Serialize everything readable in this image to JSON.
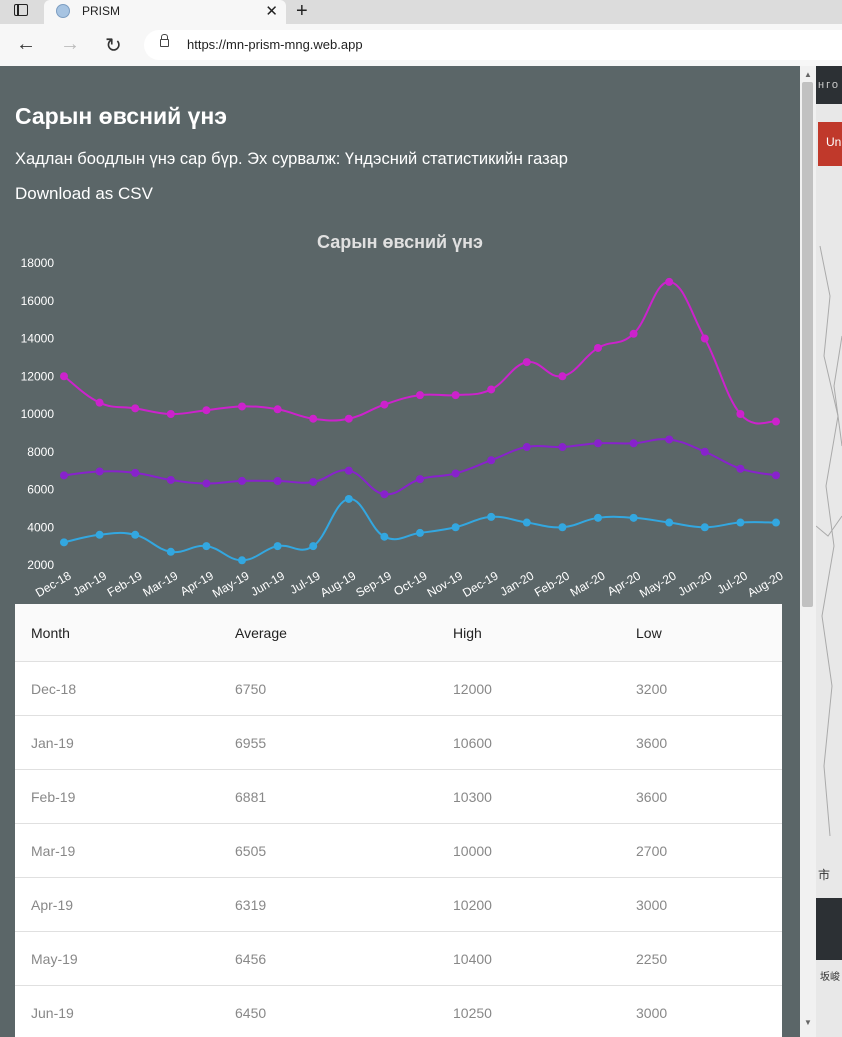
{
  "browser": {
    "tab_title": "PRISM",
    "tab_close": "✕",
    "new_tab": "+",
    "back": "←",
    "forward": "→",
    "reload": "↻",
    "url": "https://mn-prism-mng.web.app"
  },
  "map": {
    "topbar_text": "нго",
    "red_button": "Un",
    "char": "市",
    "char2": "坂峻"
  },
  "panel": {
    "title": "Сарын өвсний үнэ",
    "subtitle": "Хадлан боодлын үнэ сар бүр. Эх сурвалж: Үндэсний статистикийн газар",
    "download": "Download as CSV"
  },
  "chart_data": {
    "type": "line",
    "title": "Сарын өвсний үнэ",
    "categories": [
      "Dec-18",
      "Jan-19",
      "Feb-19",
      "Mar-19",
      "Apr-19",
      "May-19",
      "Jun-19",
      "Jul-19",
      "Aug-19",
      "Sep-19",
      "Oct-19",
      "Nov-19",
      "Dec-19",
      "Jan-20",
      "Feb-20",
      "Mar-20",
      "Apr-20",
      "May-20",
      "Jun-20",
      "Jul-20",
      "Aug-20"
    ],
    "yticks": [
      2000,
      4000,
      6000,
      8000,
      10000,
      12000,
      14000,
      16000,
      18000
    ],
    "ylim": [
      2000,
      18000
    ],
    "grid": false,
    "legend": "none",
    "series": [
      {
        "color": "#cc22cc",
        "values": [
          12000,
          10600,
          10300,
          10000,
          10200,
          10400,
          10250,
          9750,
          9750,
          10500,
          11000,
          11000,
          11300,
          12750,
          12000,
          13500,
          14250,
          17000,
          14000,
          10000,
          9600
        ]
      },
      {
        "color": "#8822cc",
        "values": [
          6750,
          6955,
          6881,
          6505,
          6319,
          6456,
          6450,
          6400,
          7000,
          5750,
          6550,
          6850,
          7550,
          8250,
          8250,
          8450,
          8450,
          8650,
          8000,
          7100,
          6750
        ]
      },
      {
        "color": "#33a7e0",
        "values": [
          3200,
          3600,
          3600,
          2700,
          3000,
          2250,
          3000,
          3000,
          5500,
          3500,
          3700,
          4000,
          4550,
          4250,
          4000,
          4500,
          4500,
          4250,
          4000,
          4250,
          4250
        ]
      }
    ]
  },
  "table": {
    "headers": [
      "Month",
      "Average",
      "High",
      "Low"
    ],
    "rows": [
      [
        "Dec-18",
        "6750",
        "12000",
        "3200"
      ],
      [
        "Jan-19",
        "6955",
        "10600",
        "3600"
      ],
      [
        "Feb-19",
        "6881",
        "10300",
        "3600"
      ],
      [
        "Mar-19",
        "6505",
        "10000",
        "2700"
      ],
      [
        "Apr-19",
        "6319",
        "10200",
        "3000"
      ],
      [
        "May-19",
        "6456",
        "10400",
        "2250"
      ],
      [
        "Jun-19",
        "6450",
        "10250",
        "3000"
      ]
    ]
  }
}
